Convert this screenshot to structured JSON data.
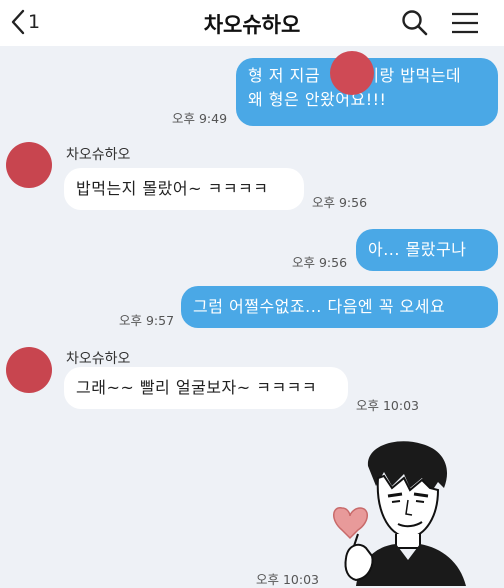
{
  "header": {
    "back_count": "1",
    "title": "차오슈하오"
  },
  "messages": [
    {
      "side": "out",
      "lines": [
        "형 저 지금 　　 이랑 밥먹는데",
        "왜 형은 안왔어요!!!"
      ],
      "time": "오후 9:49"
    },
    {
      "side": "in",
      "sender": "차오슈하오",
      "text": "밥먹는지 몰랐어~ ㅋㅋㅋㅋ",
      "time": "오후 9:56"
    },
    {
      "side": "out",
      "text": "아... 몰랐구나",
      "time": "오후 9:56"
    },
    {
      "side": "out",
      "text": "그럼 어쩔수없죠... 다음엔 꼭 오세요",
      "time": "오후 9:57"
    },
    {
      "side": "in",
      "sender": "차오슈하오",
      "text": "그래~~ 빨리 얼굴보자~ ㅋㅋㅋㅋ",
      "time": "오후 10:03"
    },
    {
      "side": "in",
      "sticker": "heart-sticker",
      "time": "오후 10:03"
    }
  ],
  "colors": {
    "outgoing_bubble": "#4aa8e6",
    "incoming_bubble": "#ffffff",
    "background": "#eef1f6",
    "avatar_redaction": "#c8454f"
  },
  "icons": [
    "back-arrow-icon",
    "search-icon",
    "menu-icon"
  ]
}
